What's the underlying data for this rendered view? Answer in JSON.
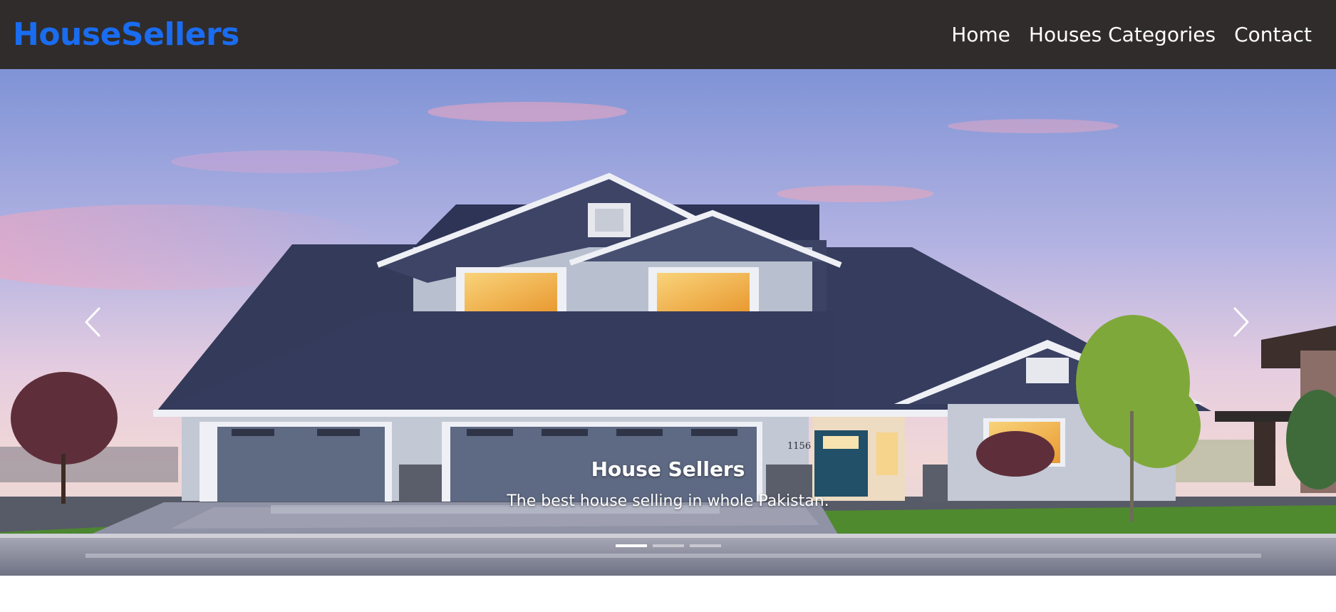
{
  "navbar": {
    "brand": "HouseSellers",
    "links": [
      "Home",
      "Houses Categories",
      "Contact"
    ]
  },
  "carousel": {
    "caption_title": "House Sellers",
    "caption_text": "The best house selling in whole Pakistan.",
    "slide_count": 3,
    "active_slide": 1,
    "house_number": "1156"
  },
  "colors": {
    "navbar_bg": "#302c2b",
    "brand": "#1a6cf0"
  },
  "icons": {
    "prev": "chevron-left-icon",
    "next": "chevron-right-icon"
  }
}
